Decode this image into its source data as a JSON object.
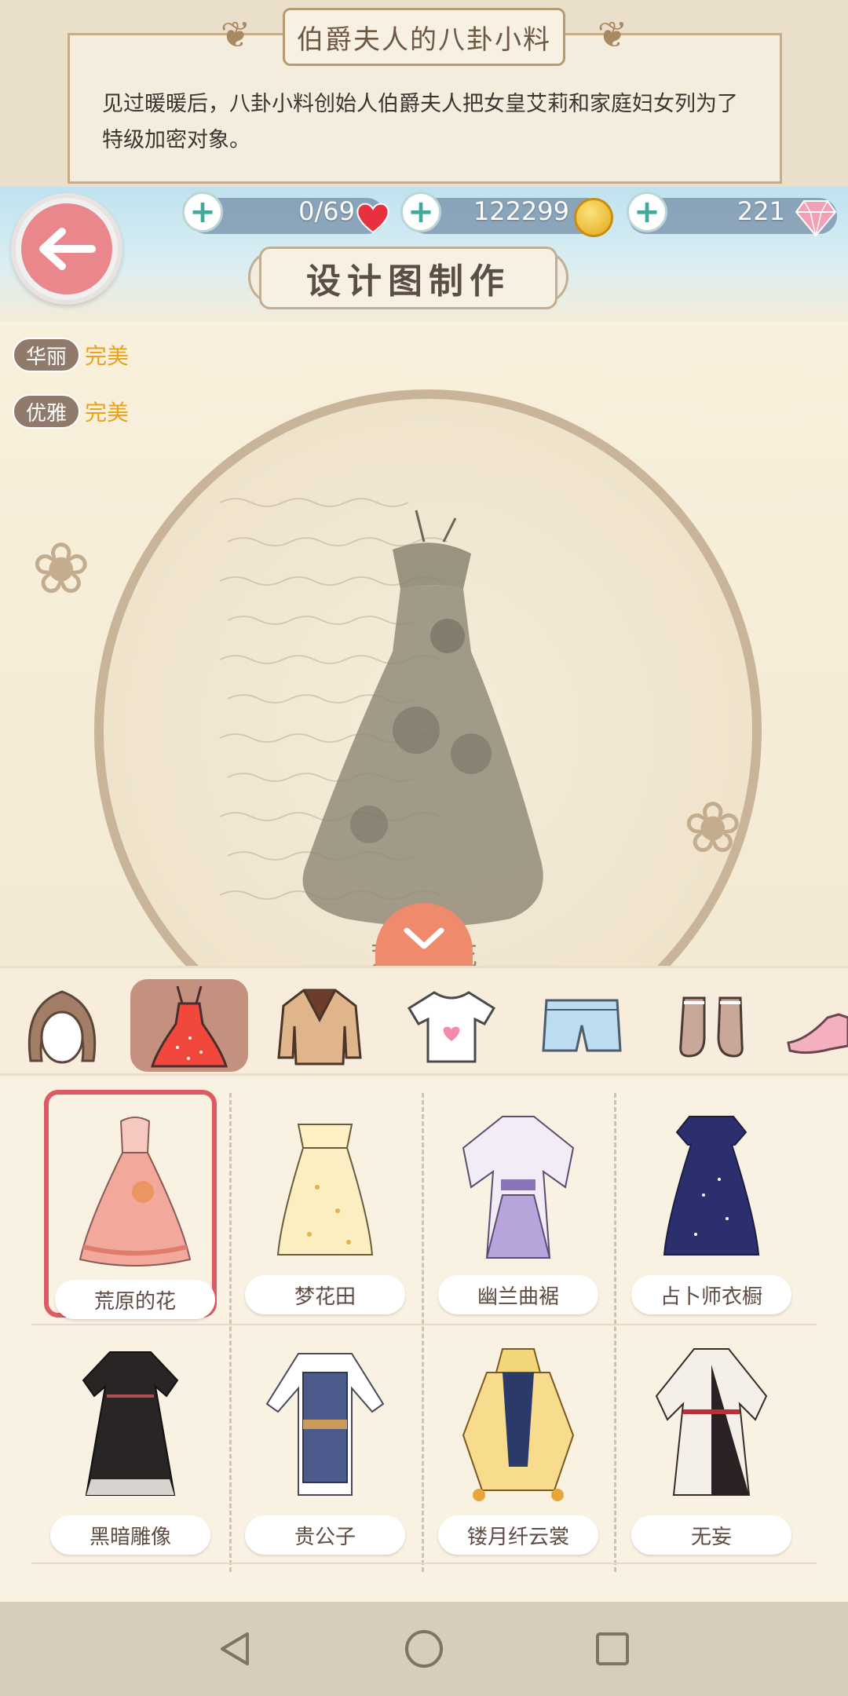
{
  "story": {
    "title": "伯爵夫人的八卦小料",
    "text": "见过暖暖后，八卦小料创始人伯爵夫人把女皇艾莉和家庭妇女列为了特级加密对象。"
  },
  "hud": {
    "stamina": "0/69",
    "coins": "122299",
    "diamonds": "221",
    "screen_title": "设计图制作"
  },
  "attributes": [
    {
      "label": "华丽",
      "value": "完美"
    },
    {
      "label": "优雅",
      "value": "完美"
    }
  ],
  "design": {
    "selected_item_name": "荒原的花"
  },
  "categories": [
    {
      "icon": "hair-icon"
    },
    {
      "icon": "dress-icon"
    },
    {
      "icon": "coat-icon"
    },
    {
      "icon": "top-icon"
    },
    {
      "icon": "shorts-icon"
    },
    {
      "icon": "socks-icon"
    },
    {
      "icon": "shoes-icon"
    }
  ],
  "items": [
    {
      "name": "荒原的花",
      "selected": true
    },
    {
      "name": "梦花田"
    },
    {
      "name": "幽兰曲裾"
    },
    {
      "name": "占卜师衣橱"
    },
    {
      "name": "黑暗雕像"
    },
    {
      "name": "贵公子"
    },
    {
      "name": "镂月纤云裳"
    },
    {
      "name": "无妄"
    }
  ],
  "colors": {
    "accent": "#e05a63",
    "attribute_value": "#e8a21c",
    "back_button": "#e9878d"
  }
}
